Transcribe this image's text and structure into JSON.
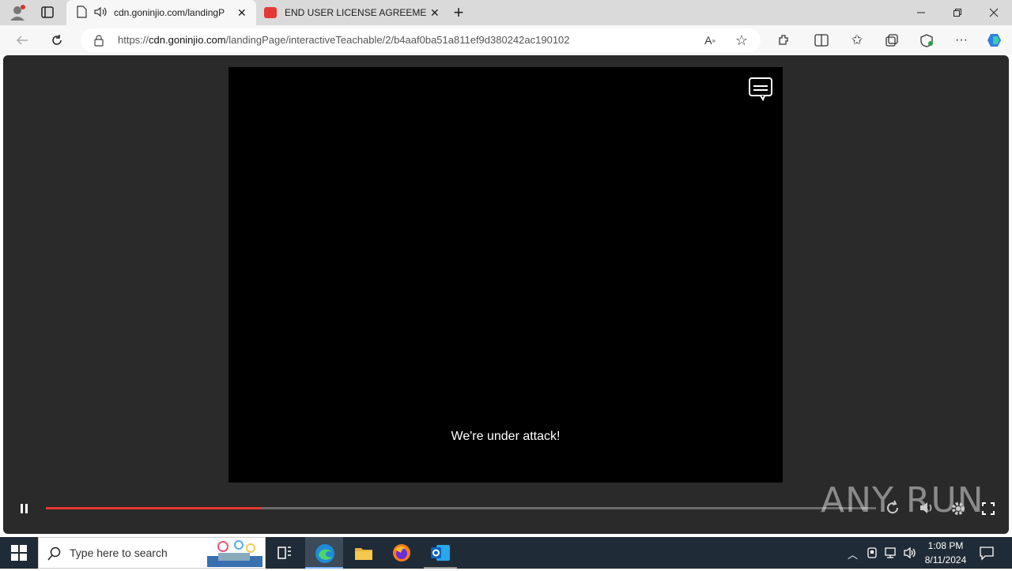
{
  "browser": {
    "tabs": [
      {
        "title": "cdn.goninjio.com/landingP"
      },
      {
        "title": "END USER LICENSE AGREEMENT"
      }
    ],
    "url_prefix": "https://",
    "url_host": "cdn.goninjio.com",
    "url_path": "/landingPage/interactiveTeachable/2/b4aaf0ba51a811ef9d380242ac190102"
  },
  "video": {
    "subtitle": "We're under attack!",
    "progress_fraction": 0.26
  },
  "watermark": "ANY RUN",
  "taskbar": {
    "search_placeholder": "Type here to search",
    "time": "1:08 PM",
    "date": "8/11/2024"
  },
  "colors": {
    "progress": "#e53935",
    "page_bg": "#2a2a2a",
    "taskbar": "#1f2b36"
  }
}
